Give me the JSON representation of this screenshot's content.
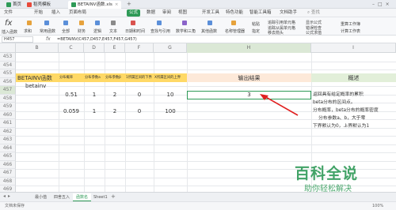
{
  "titlebar": {
    "tabs": [
      {
        "label": "首页"
      },
      {
        "label": "稻壳模板"
      },
      {
        "label": "BETAINV函数.xls"
      }
    ]
  },
  "menu": {
    "items": [
      "文件",
      "开始",
      "插入",
      "页面布局",
      "公式",
      "数据",
      "审阅",
      "视图",
      "开发工具",
      "特色功能",
      "智能工具箱",
      "文档助手"
    ],
    "search": "查找"
  },
  "ribbon": {
    "fx_label": "插入函数",
    "items": [
      "求和",
      "常用函数",
      "全部",
      "财务",
      "逻辑",
      "文本",
      "日期和时间",
      "查找与引用",
      "数学和三角",
      "其他函数",
      "名称管理器",
      "粘贴",
      "指定",
      "追踪引用单元格",
      "追踪从属单元格",
      "移去箭头",
      "显示公式",
      "错误检查",
      "公式求值",
      "重算工作簿",
      "计算工作表"
    ]
  },
  "formula_bar": {
    "name_box": "H457",
    "fx": "fx",
    "formula": "=BETAINV(C457,D457,E457,F457,G457)"
  },
  "columns": [
    "",
    "B",
    "C",
    "D",
    "E",
    "F",
    "G",
    "H",
    "I"
  ],
  "rows": [
    "453",
    "454",
    "455",
    "456",
    "457",
    "458",
    "459",
    "460",
    "461",
    "462",
    "463",
    "464",
    "465",
    "466",
    "467",
    "468",
    "469"
  ],
  "cells": {
    "title": "BETAINV函数",
    "subtitle": "betainv",
    "hdr_c": "分布概率",
    "hdr_d": "分布参数a",
    "hdr_e": "分布参数β",
    "hdr_f": "1所属区间的下界",
    "hdr_g": "X所属区间的上界",
    "hdr_h": "输出结果",
    "hdr_i": "概述",
    "r1": [
      "0.51",
      "1",
      "2",
      "0",
      "10"
    ],
    "r1_result": "3",
    "r2": [
      "0.059",
      "1",
      "2",
      "0",
      "100"
    ],
    "desc": [
      "返回具有给定概率的累积",
      "beta分布的区间点。",
      "分布概率，beta分布的概率密度",
      "分布参数a、b，大于零",
      "下界默认为0，上界默认为1"
    ]
  },
  "sheets": [
    "最小值",
    "四舍五入",
    "函数名",
    "Sheet1"
  ],
  "active_sheet": "函数名",
  "status": {
    "left": "文档未保存",
    "zoom": "100%"
  },
  "watermark": {
    "title": "百科全说",
    "subtitle": "助你轻松解决"
  },
  "colors": {
    "accent": "#2e9a57",
    "header_fill": "#ffd966",
    "result_fill": "#fde9d9",
    "desc_fill": "#e2efd9",
    "arrow": "#e02020"
  }
}
